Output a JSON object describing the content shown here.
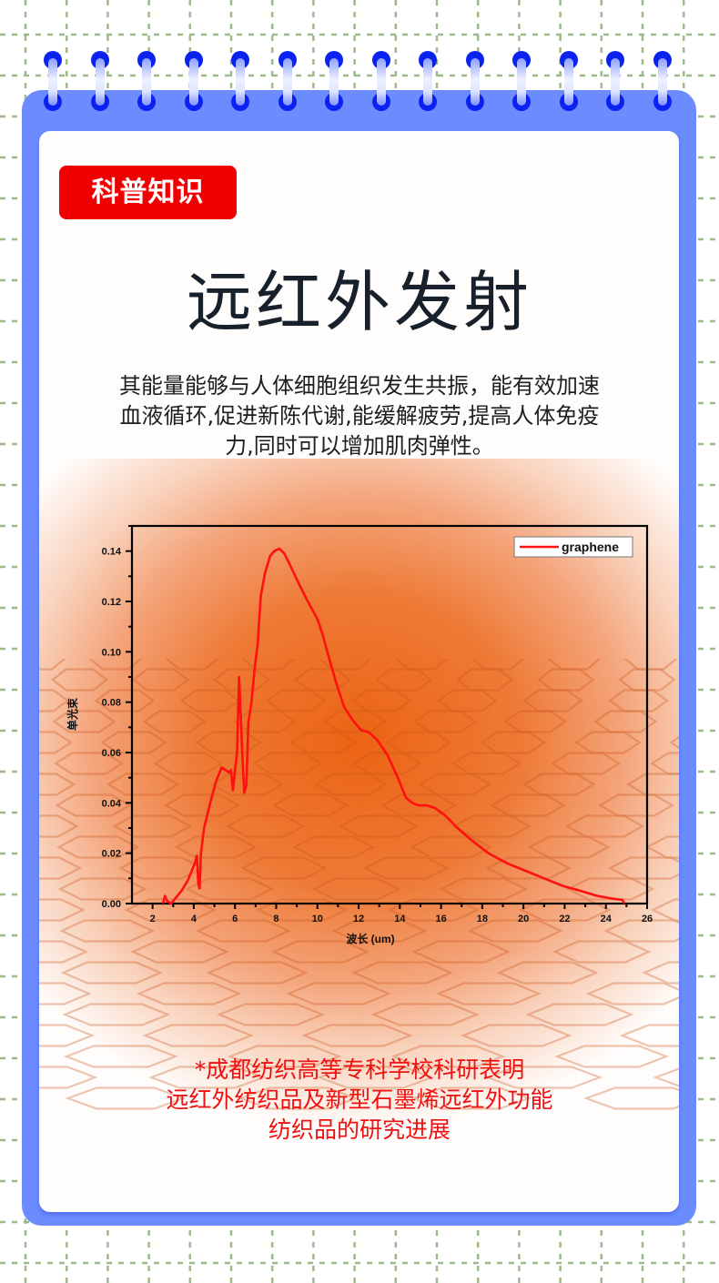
{
  "badge": {
    "label": "科普知识"
  },
  "title": "远红外发射",
  "intro": {
    "lines": [
      "其能量能够与人体细胞组织发生共振，能有效加速",
      "血液循环,促进新陈代谢,能缓解疲劳,提高人体免疫",
      "力,同时可以增加肌肉弹性。"
    ]
  },
  "footnote": {
    "lines": [
      "*成都纺织高等专科学校科研表明",
      "远红外纺织品及新型石墨烯远红外功能",
      "纺织品的研究进展"
    ]
  },
  "colors": {
    "frame": "#6b8bff",
    "ring": "#0a22f0",
    "badge": "#f00000",
    "grid": "#9dbb8a",
    "series": "#ff1010",
    "footnote": "#f01010"
  },
  "rings_count": 14,
  "chart_data": {
    "type": "line",
    "title": "",
    "xlabel": "波长  (um)",
    "ylabel": "单光束",
    "xlim": [
      1,
      26
    ],
    "ylim": [
      0,
      0.15
    ],
    "xticks": [
      2,
      4,
      6,
      8,
      10,
      12,
      14,
      16,
      18,
      20,
      22,
      24,
      26
    ],
    "yticks": [
      0.0,
      0.02,
      0.04,
      0.06,
      0.08,
      0.1,
      0.12,
      0.14
    ],
    "xtick_labels": [
      "2",
      "4",
      "6",
      "8",
      "10",
      "12",
      "14",
      "16",
      "18",
      "20",
      "22",
      "24",
      "26"
    ],
    "ytick_labels": [
      "0.00",
      "0.02",
      "0.04",
      "0.06",
      "0.08",
      "0.10",
      "0.12",
      "0.14"
    ],
    "grid": false,
    "legend": {
      "position": "top-right",
      "entries": [
        "graphene"
      ]
    },
    "series": [
      {
        "name": "graphene",
        "color": "#ff1010",
        "x": [
          2.5,
          2.6,
          2.7,
          2.9,
          3.1,
          3.4,
          3.7,
          3.9,
          4.05,
          4.15,
          4.22,
          4.28,
          4.35,
          4.5,
          4.8,
          5.1,
          5.35,
          5.55,
          5.7,
          5.8,
          5.9,
          6.0,
          6.1,
          6.2,
          6.28,
          6.35,
          6.45,
          6.55,
          6.65,
          6.8,
          6.95,
          7.1,
          7.25,
          7.45,
          7.7,
          7.9,
          8.15,
          8.4,
          8.7,
          9.1,
          9.6,
          10.0,
          10.25,
          10.55,
          10.9,
          11.3,
          11.7,
          12.1,
          12.5,
          12.9,
          13.4,
          13.9,
          14.3,
          14.6,
          14.9,
          15.3,
          15.7,
          16.2,
          16.8,
          17.5,
          18.3,
          19.2,
          20.1,
          21.0,
          21.9,
          22.8,
          23.6,
          24.3,
          24.8,
          24.9
        ],
        "y": [
          0.0,
          0.003,
          0.001,
          0.0,
          0.002,
          0.005,
          0.009,
          0.013,
          0.016,
          0.019,
          0.008,
          0.006,
          0.02,
          0.03,
          0.04,
          0.049,
          0.054,
          0.053,
          0.052,
          0.053,
          0.045,
          0.053,
          0.06,
          0.09,
          0.075,
          0.06,
          0.044,
          0.047,
          0.072,
          0.08,
          0.093,
          0.103,
          0.122,
          0.131,
          0.138,
          0.14,
          0.141,
          0.139,
          0.134,
          0.127,
          0.119,
          0.113,
          0.107,
          0.098,
          0.088,
          0.078,
          0.073,
          0.069,
          0.068,
          0.065,
          0.059,
          0.05,
          0.042,
          0.04,
          0.039,
          0.039,
          0.038,
          0.035,
          0.03,
          0.025,
          0.02,
          0.016,
          0.013,
          0.01,
          0.007,
          0.005,
          0.003,
          0.002,
          0.0015,
          0.0
        ]
      }
    ]
  }
}
